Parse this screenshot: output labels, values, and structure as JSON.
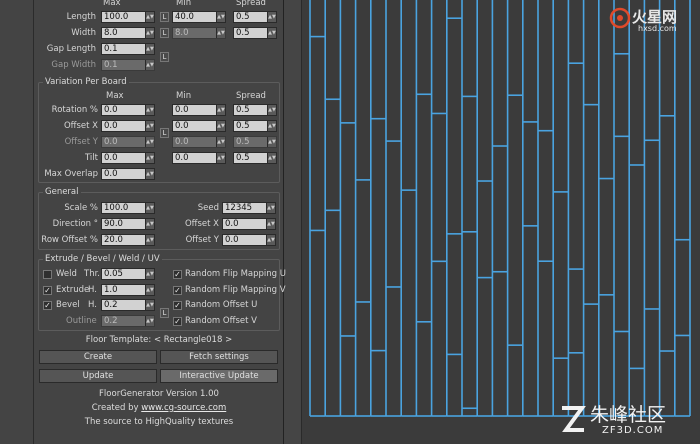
{
  "header_cols": {
    "max": "Max",
    "min": "Min",
    "spread": "Spread"
  },
  "board": {
    "length": {
      "label": "Length",
      "max": "100.0",
      "min": "40.0",
      "spread": "0.5"
    },
    "width": {
      "label": "Width",
      "max": "8.0",
      "min": "8.0",
      "spread": "0.5"
    },
    "gap_length": {
      "label": "Gap Length",
      "value": "0.1"
    },
    "gap_width": {
      "label": "Gap Width",
      "value": "0.1"
    },
    "lock": "L"
  },
  "variation": {
    "title": "Variation Per Board",
    "rotation": {
      "label": "Rotation %",
      "max": "0.0",
      "min": "0.0",
      "spread": "0.5"
    },
    "offset_x": {
      "label": "Offset X",
      "max": "0.0",
      "min": "0.0",
      "spread": "0.5"
    },
    "offset_y": {
      "label": "Offset Y",
      "max": "0.0",
      "min": "0.0",
      "spread": "0.5"
    },
    "tilt": {
      "label": "Tilt",
      "max": "0.0",
      "min": "0.0",
      "spread": "0.5"
    },
    "max_overlap": {
      "label": "Max Overlap",
      "value": "0.0"
    }
  },
  "general": {
    "title": "General",
    "scale": {
      "label": "Scale %",
      "value": "100.0"
    },
    "direction": {
      "label": "Direction °",
      "value": "90.0"
    },
    "row_offset": {
      "label": "Row Offset %",
      "value": "20.0"
    },
    "seed": {
      "label": "Seed",
      "value": "12345"
    },
    "offset_x": {
      "label": "Offset X",
      "value": "0.0"
    },
    "offset_y": {
      "label": "Offset Y",
      "value": "0.0"
    }
  },
  "extrude": {
    "title": "Extrude / Bevel / Weld / UV",
    "weld": {
      "label": "Weld",
      "checked": false,
      "param": "Thr.",
      "value": "0.05"
    },
    "extrude": {
      "label": "Extrude",
      "checked": true,
      "param": "H.",
      "value": "1.0"
    },
    "bevel": {
      "label": "Bevel",
      "checked": true,
      "param": "H.",
      "value": "0.2"
    },
    "outline": {
      "label": "Outline",
      "value": "0.2"
    },
    "random_flip_u": {
      "label": "Random Flip Mapping U",
      "checked": true
    },
    "random_flip_v": {
      "label": "Random Flip Mapping V",
      "checked": true
    },
    "random_offset_u": {
      "label": "Random Offset U",
      "checked": true
    },
    "random_offset_v": {
      "label": "Random Offset V",
      "checked": true
    }
  },
  "floor_template": "Floor Template: < Rectangle018 >",
  "buttons": {
    "create": "Create",
    "fetch": "Fetch settings",
    "update": "Update",
    "interactive_update": "Interactive Update"
  },
  "footer": {
    "version": "FloorGenerator Version 1.00",
    "created_by": "Created by",
    "link": "www.cg-source.com",
    "tagline": "The source to HighQuality textures"
  },
  "watermark_top": {
    "brand": "火星网",
    "url": "hxsd.com"
  },
  "watermark_bottom": {
    "brand": "朱峰社区",
    "url": "ZF3D.COM"
  },
  "colors": {
    "plank_line": "#4aa3e0",
    "viewport_bg": "#3b3b3b",
    "panel_bg": "#444444"
  }
}
